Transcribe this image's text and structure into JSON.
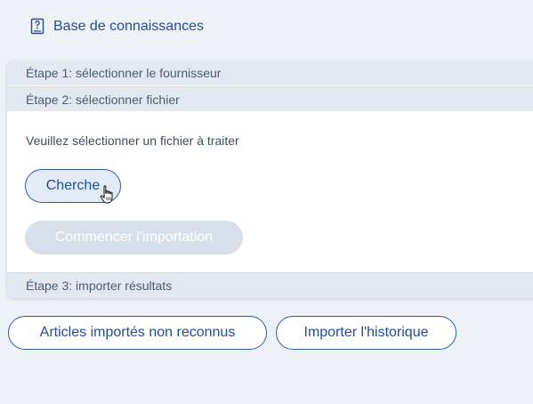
{
  "header": {
    "kb_link_label": "Base de connaissances",
    "kb_icon": "help-book-icon"
  },
  "wizard": {
    "step1_label": "Étape 1: sélectionner le fournisseur",
    "step2_label": "Étape 2: sélectionner fichier",
    "step2": {
      "instruction": "Veuillez sélectionner un fichier à traiter",
      "browse_label": "Cherche",
      "start_import_label": "Commencer l'importation",
      "start_import_enabled": false
    },
    "step3_label": "Étape 3: importer résultats"
  },
  "actions": {
    "unrecognized_label": "Articles importés non reconnus",
    "history_label": "Importer l'historique"
  },
  "colors": {
    "accent": "#1f4e96",
    "page_bg": "#eef1f6",
    "step_header_bg": "#e4e9f1",
    "disabled_button_bg": "#d7dfeb"
  }
}
